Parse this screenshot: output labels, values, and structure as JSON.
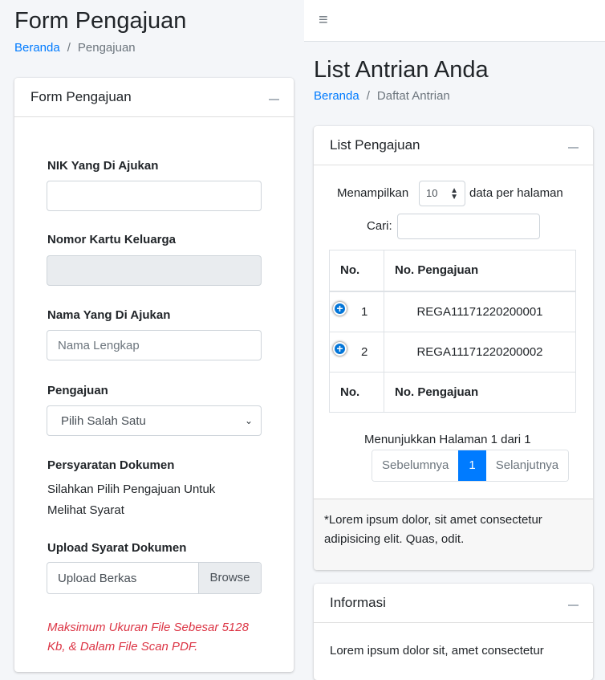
{
  "left": {
    "title": "Form Pengajuan",
    "breadcrumb": {
      "home": "Beranda",
      "current": "Pengajuan"
    },
    "card_title": "Form Pengajuan",
    "nik_label": "NIK Yang Di Ajukan",
    "nik_value": "",
    "kk_label": "Nomor Kartu Keluarga",
    "kk_value": "",
    "nama_label": "Nama Yang Di Ajukan",
    "nama_placeholder": "Nama Lengkap",
    "pengajuan_label": "Pengajuan",
    "pengajuan_selected": "Pilih Salah Satu",
    "persyaratan_label": "Persyaratan Dokumen",
    "persyaratan_text_1": "Silahkan Pilih Pengajuan Untuk",
    "persyaratan_text_2": "Melihat Syarat",
    "upload_label": "Upload Syarat Dokumen",
    "upload_placeholder": "Upload Berkas",
    "browse_label": "Browse",
    "warning_1": "Maksimum Ukuran File Sebesar 5128",
    "warning_2": "Kb, & Dalam File Scan PDF."
  },
  "right": {
    "hamburger_glyph": "≡",
    "title": "List Antrian Anda",
    "breadcrumb": {
      "home": "Beranda",
      "current": "Daftat Antrian"
    },
    "card_title": "List Pengajuan",
    "length": {
      "prefix": "Menampilkan",
      "value": "10",
      "suffix": "data per halaman"
    },
    "search_label": "Cari:",
    "search_value": "",
    "table": {
      "headers": [
        "No.",
        "No. Pengajuan"
      ],
      "rows": [
        {
          "no": "1",
          "code": "REGA11171220200001"
        },
        {
          "no": "2",
          "code": "REGA11171220200002"
        }
      ],
      "footers": [
        "No.",
        "No. Pengajuan"
      ]
    },
    "info": "Menunjukkan Halaman 1 dari 1",
    "pager": {
      "prev": "Sebelumnya",
      "current": "1",
      "next": "Selanjutnya"
    },
    "note_1": "*Lorem ipsum dolor, sit amet consectetur",
    "note_2": "adipisicing elit. Quas, odit.",
    "info_card_title": "Informasi",
    "info_text": "Lorem ipsum dolor sit, amet consectetur"
  },
  "colors": {
    "accent": "#007bff",
    "danger": "#dc3545",
    "row_toggle": "#0275d8"
  }
}
